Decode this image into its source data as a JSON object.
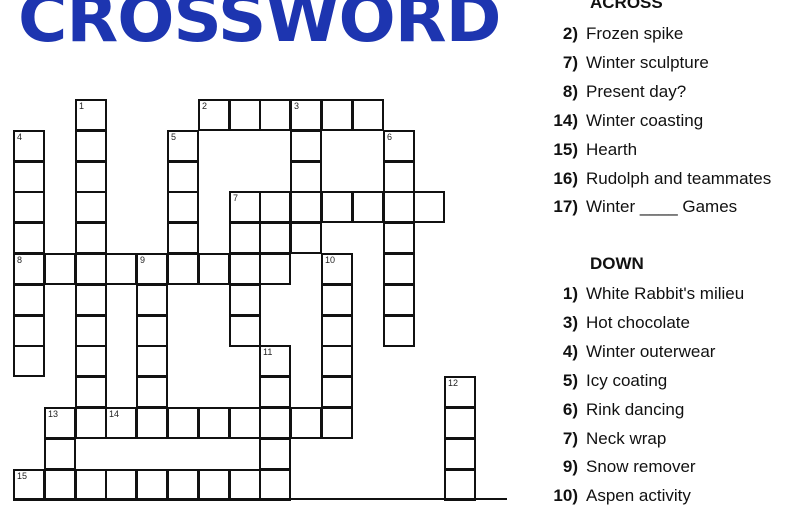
{
  "title": "CROSSWORD",
  "colors": {
    "title": "#1d35b0",
    "grid_line": "#111111",
    "text": "#111111"
  },
  "puzzle": {
    "cells": [
      {
        "r": 0,
        "c": 2,
        "n": "1"
      },
      {
        "r": 1,
        "c": 2
      },
      {
        "r": 2,
        "c": 2
      },
      {
        "r": 3,
        "c": 2
      },
      {
        "r": 4,
        "c": 2
      },
      {
        "r": 5,
        "c": 2
      },
      {
        "r": 6,
        "c": 2
      },
      {
        "r": 7,
        "c": 2
      },
      {
        "r": 8,
        "c": 2
      },
      {
        "r": 9,
        "c": 2
      },
      {
        "r": 10,
        "c": 2
      },
      {
        "r": 0,
        "c": 6,
        "n": "2"
      },
      {
        "r": 0,
        "c": 7
      },
      {
        "r": 0,
        "c": 8
      },
      {
        "r": 0,
        "c": 9,
        "n": "3"
      },
      {
        "r": 0,
        "c": 10
      },
      {
        "r": 0,
        "c": 11
      },
      {
        "r": 1,
        "c": 9
      },
      {
        "r": 2,
        "c": 9
      },
      {
        "r": 3,
        "c": 9
      },
      {
        "r": 4,
        "c": 9
      },
      {
        "r": 1,
        "c": 0,
        "n": "4"
      },
      {
        "r": 2,
        "c": 0
      },
      {
        "r": 3,
        "c": 0
      },
      {
        "r": 4,
        "c": 0
      },
      {
        "r": 5,
        "c": 0,
        "n": "8"
      },
      {
        "r": 6,
        "c": 0
      },
      {
        "r": 7,
        "c": 0
      },
      {
        "r": 8,
        "c": 0
      },
      {
        "r": 1,
        "c": 5,
        "n": "5"
      },
      {
        "r": 2,
        "c": 5
      },
      {
        "r": 3,
        "c": 5
      },
      {
        "r": 4,
        "c": 5
      },
      {
        "r": 5,
        "c": 5
      },
      {
        "r": 1,
        "c": 12,
        "n": "6"
      },
      {
        "r": 2,
        "c": 12
      },
      {
        "r": 3,
        "c": 12
      },
      {
        "r": 4,
        "c": 12
      },
      {
        "r": 5,
        "c": 12
      },
      {
        "r": 6,
        "c": 12
      },
      {
        "r": 7,
        "c": 12
      },
      {
        "r": 3,
        "c": 7,
        "n": "7"
      },
      {
        "r": 3,
        "c": 8
      },
      {
        "r": 3,
        "c": 10
      },
      {
        "r": 3,
        "c": 11
      },
      {
        "r": 3,
        "c": 13
      },
      {
        "r": 4,
        "c": 7
      },
      {
        "r": 4,
        "c": 8
      },
      {
        "r": 5,
        "c": 7
      },
      {
        "r": 6,
        "c": 7
      },
      {
        "r": 7,
        "c": 7
      },
      {
        "r": 5,
        "c": 1
      },
      {
        "r": 5,
        "c": 3
      },
      {
        "r": 5,
        "c": 4,
        "n": "9"
      },
      {
        "r": 5,
        "c": 6
      },
      {
        "r": 5,
        "c": 8
      },
      {
        "r": 6,
        "c": 4
      },
      {
        "r": 7,
        "c": 4
      },
      {
        "r": 8,
        "c": 4
      },
      {
        "r": 9,
        "c": 4
      },
      {
        "r": 5,
        "c": 10,
        "n": "10"
      },
      {
        "r": 6,
        "c": 10
      },
      {
        "r": 7,
        "c": 10
      },
      {
        "r": 8,
        "c": 10
      },
      {
        "r": 9,
        "c": 10
      },
      {
        "r": 10,
        "c": 10
      },
      {
        "r": 8,
        "c": 8,
        "n": "11"
      },
      {
        "r": 9,
        "c": 8
      },
      {
        "r": 10,
        "c": 8
      },
      {
        "r": 11,
        "c": 8
      },
      {
        "r": 12,
        "c": 8
      },
      {
        "r": 9,
        "c": 14,
        "n": "12"
      },
      {
        "r": 10,
        "c": 14
      },
      {
        "r": 11,
        "c": 14
      },
      {
        "r": 12,
        "c": 14
      },
      {
        "r": 10,
        "c": 1,
        "n": "13"
      },
      {
        "r": 11,
        "c": 1
      },
      {
        "r": 12,
        "c": 1
      },
      {
        "r": 10,
        "c": 3,
        "n": "14"
      },
      {
        "r": 10,
        "c": 4
      },
      {
        "r": 10,
        "c": 5
      },
      {
        "r": 10,
        "c": 6
      },
      {
        "r": 10,
        "c": 7
      },
      {
        "r": 10,
        "c": 9
      },
      {
        "r": 12,
        "c": 0,
        "n": "15"
      },
      {
        "r": 12,
        "c": 2
      },
      {
        "r": 12,
        "c": 3
      },
      {
        "r": 12,
        "c": 4
      },
      {
        "r": 12,
        "c": 5
      },
      {
        "r": 12,
        "c": 6
      },
      {
        "r": 12,
        "c": 7
      }
    ]
  },
  "across": {
    "header": "ACROSS",
    "clues": [
      {
        "num": "2)",
        "text": "Frozen spike"
      },
      {
        "num": "7)",
        "text": "Winter sculpture"
      },
      {
        "num": "8)",
        "text": "Present day?"
      },
      {
        "num": "14)",
        "text": "Winter coasting"
      },
      {
        "num": "15)",
        "text": "Hearth"
      },
      {
        "num": "16)",
        "text": "Rudolph and teammates"
      },
      {
        "num": "17)",
        "text": "Winter ____ Games"
      }
    ]
  },
  "down": {
    "header": "DOWN",
    "clues": [
      {
        "num": "1)",
        "text": "White Rabbit's milieu"
      },
      {
        "num": "3)",
        "text": "Hot chocolate"
      },
      {
        "num": "4)",
        "text": "Winter outerwear"
      },
      {
        "num": "5)",
        "text": "Icy coating"
      },
      {
        "num": "6)",
        "text": "Rink dancing"
      },
      {
        "num": "7)",
        "text": "Neck wrap"
      },
      {
        "num": "9)",
        "text": "Snow remover"
      },
      {
        "num": "10)",
        "text": "Aspen activity"
      }
    ]
  }
}
